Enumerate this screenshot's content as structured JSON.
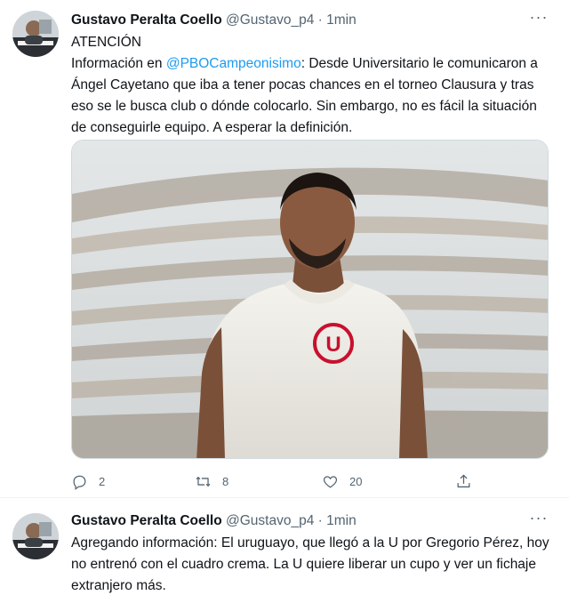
{
  "tweets": [
    {
      "display_name": "Gustavo Peralta Coello",
      "handle": "@Gustavo_p4",
      "separator": "·",
      "time": "1min",
      "avatar_icon": "profile-photo-icon",
      "text_line_1": "ATENCIÓN",
      "text_prefix": "Información en ",
      "mention": "@PBOCampeonisimo",
      "text_rest": ": Desde Universitario  le comunicaron a Ángel Cayetano que iba a tener pocas chances en el torneo Clausura y tras eso se le busca club o dónde colocarlo. Sin embargo, no es fácil la situación de conseguirle equipo. A esperar la definición.",
      "media_icon": "photo-player-in-stadium",
      "actions": {
        "replies": "2",
        "retweets": "8",
        "likes": "20"
      }
    },
    {
      "display_name": "Gustavo Peralta Coello",
      "handle": "@Gustavo_p4",
      "separator": "·",
      "time": "1min",
      "avatar_icon": "profile-photo-icon",
      "text": "Agregando información: El uruguayo, que llegó a la U por Gregorio Pérez, hoy no entrenó con el cuadro crema. La U quiere liberar un cupo y ver un fichaje extranjero más."
    }
  ],
  "colors": {
    "link": "#1d9bf0",
    "secondary_text": "#536471",
    "primary_text": "#0f1419",
    "badge_red": "#c8102e"
  }
}
